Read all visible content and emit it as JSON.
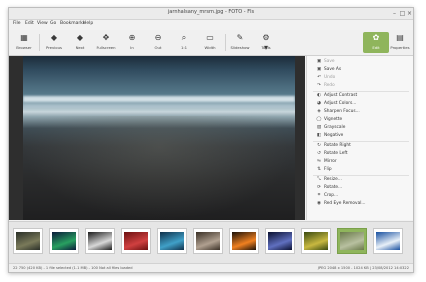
{
  "window": {
    "title": "jarnhalsany_mrsrn.jpg - FOTO - Fls"
  },
  "menu": [
    "File",
    "Edit",
    "View",
    "Go",
    "Bookmarks",
    "Help"
  ],
  "toolbar": {
    "left": [
      {
        "label": "Browser",
        "icon": "browser-icon"
      },
      {
        "label": "Previous",
        "icon": "previous-icon"
      },
      {
        "label": "Next",
        "icon": "next-icon"
      },
      {
        "label": "Fullscreen",
        "icon": "fullscreen-icon"
      },
      {
        "label": "In",
        "icon": "zoom-in-icon"
      },
      {
        "label": "Out",
        "icon": "zoom-out-icon"
      },
      {
        "label": "1:1",
        "icon": "actual-size-icon"
      },
      {
        "label": "Width",
        "icon": "fit-width-icon"
      },
      {
        "label": "Slideshow",
        "icon": "slideshow-icon"
      },
      {
        "label": "Tools",
        "icon": "tools-icon"
      }
    ],
    "right": [
      {
        "label": "Edit",
        "icon": "edit-icon",
        "active": true
      },
      {
        "label": "Properties",
        "icon": "properties-icon"
      }
    ]
  },
  "sidebar": {
    "items": [
      {
        "label": "Save",
        "icon": "save-icon",
        "disabled": true
      },
      {
        "label": "Save As",
        "icon": "save-as-icon",
        "disabled": false
      },
      {
        "label": "Undo",
        "icon": "undo-icon",
        "disabled": true
      },
      {
        "label": "Redo",
        "icon": "redo-icon",
        "disabled": true
      },
      {
        "label": "Adjust Contrast",
        "icon": "contrast-icon",
        "disabled": false
      },
      {
        "label": "Adjust Colors...",
        "icon": "colors-icon",
        "disabled": false
      },
      {
        "label": "Sharpen Focus...",
        "icon": "sharpen-icon",
        "disabled": false
      },
      {
        "label": "Vignette",
        "icon": "vignette-icon",
        "disabled": false
      },
      {
        "label": "Grayscale",
        "icon": "grayscale-icon",
        "disabled": false
      },
      {
        "label": "Negative",
        "icon": "negative-icon",
        "disabled": false
      },
      {
        "label": "Rotate Right",
        "icon": "rotate-right-icon",
        "disabled": false
      },
      {
        "label": "Rotate Left",
        "icon": "rotate-left-icon",
        "disabled": false
      },
      {
        "label": "Mirror",
        "icon": "mirror-icon",
        "disabled": false
      },
      {
        "label": "Flip",
        "icon": "flip-icon",
        "disabled": false
      },
      {
        "label": "Resize...",
        "icon": "resize-icon",
        "disabled": false
      },
      {
        "label": "Rotate...",
        "icon": "rotate-icon",
        "disabled": false
      },
      {
        "label": "Crop...",
        "icon": "crop-icon",
        "disabled": false
      },
      {
        "label": "Red Eye Removal...",
        "icon": "red-eye-icon",
        "disabled": false
      }
    ]
  },
  "thumbnails": [
    {
      "name": "thumb-1",
      "colors": [
        "#2a2f28",
        "#7a7a5a"
      ]
    },
    {
      "name": "thumb-2",
      "colors": [
        "#0a1a3a",
        "#28a060"
      ]
    },
    {
      "name": "thumb-3",
      "colors": [
        "#1c1c1c",
        "#d8d8d8"
      ]
    },
    {
      "name": "thumb-4",
      "colors": [
        "#6b1010",
        "#d04040"
      ]
    },
    {
      "name": "thumb-5",
      "colors": [
        "#10304a",
        "#40a0c8"
      ]
    },
    {
      "name": "thumb-6",
      "colors": [
        "#3a3026",
        "#b0a090"
      ]
    },
    {
      "name": "thumb-7",
      "colors": [
        "#1a1008",
        "#f08020"
      ]
    },
    {
      "name": "thumb-8",
      "colors": [
        "#0a1030",
        "#6070c0"
      ]
    },
    {
      "name": "thumb-9",
      "colors": [
        "#3a4a10",
        "#c8b840"
      ]
    },
    {
      "name": "thumb-10",
      "colors": [
        "#6a7a4a",
        "#b8c0a0"
      ],
      "selected": true
    },
    {
      "name": "thumb-11",
      "colors": [
        "#1850a0",
        "#e8f0f8"
      ]
    }
  ],
  "status": {
    "left": "22 750 (420 KB) - 1 file selected (1.1 MB)  - 100  Not all files loaded",
    "right": "JPEG  2048 x 1500 - 1024  KB  | 23/08/2012 14:0322"
  },
  "colors": {
    "accent": "#8fb55c"
  }
}
